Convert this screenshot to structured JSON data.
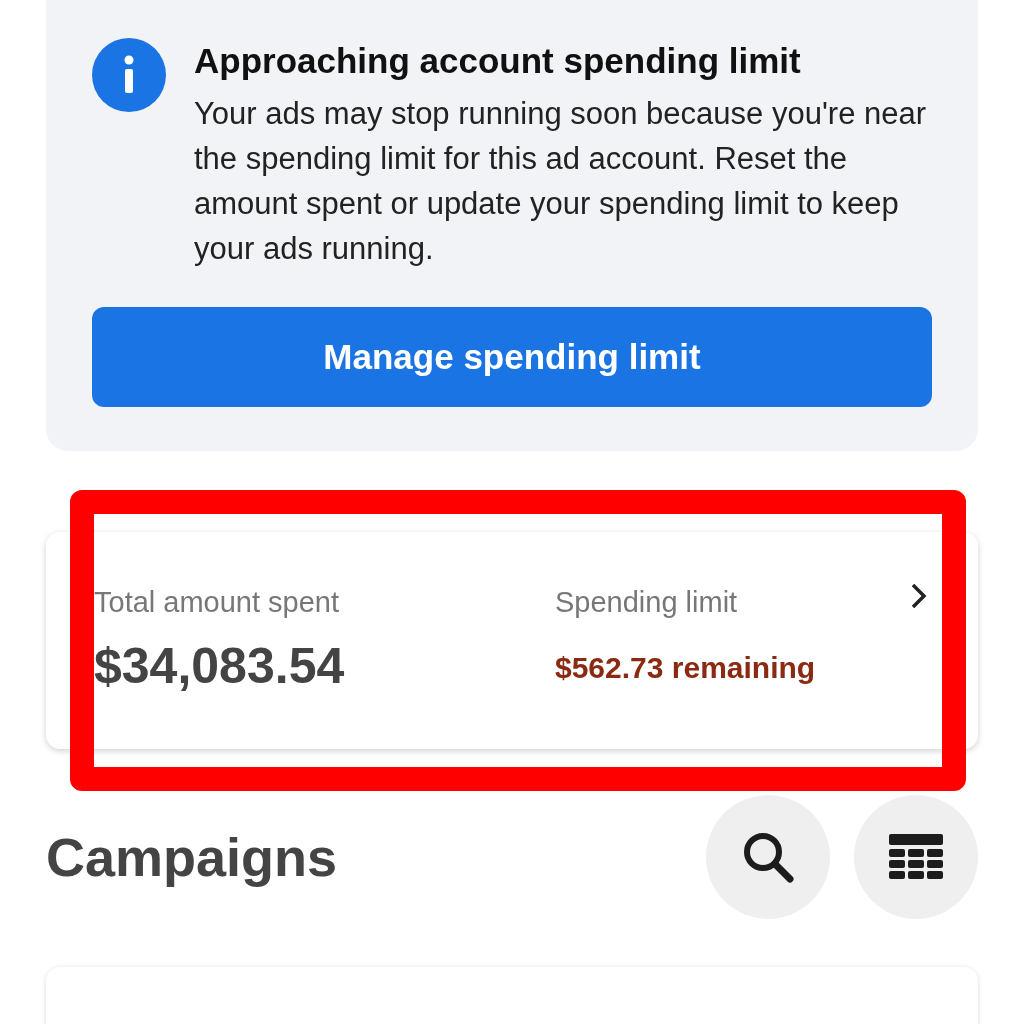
{
  "alert": {
    "title": "Approaching account spending limit",
    "body": "Your ads may stop running soon because you're near the spending limit for this ad account. Reset the amount spent or update your spending limit to keep your ads running.",
    "button": "Manage spending limit"
  },
  "summary": {
    "highlighted": true,
    "items": [
      {
        "kind": "amount",
        "label": "Total amount spent",
        "value": "$34,083.54"
      },
      {
        "kind": "warning",
        "label": "Spending limit",
        "value": "$562.73 remaining"
      }
    ]
  },
  "campaigns": {
    "title": "Campaigns"
  }
}
